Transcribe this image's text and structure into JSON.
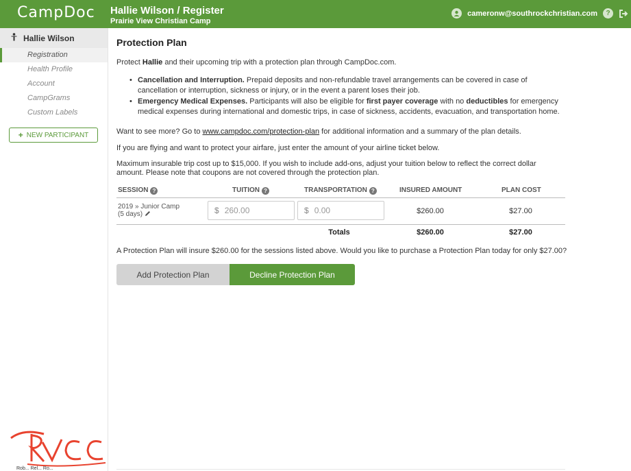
{
  "header": {
    "logo": "CampDoc",
    "title": "Hallie Wilson / Register",
    "subtitle": "Prairie View Christian Camp",
    "user_email": "cameronw@southrockchristian.com",
    "brand_color": "#5b9a3a"
  },
  "sidebar": {
    "participant_name": "Hallie Wilson",
    "items": [
      {
        "label": "Registration",
        "active": true
      },
      {
        "label": "Health Profile"
      },
      {
        "label": "Account"
      },
      {
        "label": "CampGrams"
      },
      {
        "label": "Custom Labels"
      }
    ],
    "new_participant_label": "NEW PARTICIPANT",
    "logo_text": "RVCC",
    "logo_tagline": "Rob... Rel... Ro..."
  },
  "main": {
    "title": "Protection Plan",
    "intro_pre": "Protect ",
    "intro_name": "Hallie",
    "intro_post": " and their upcoming trip with a protection plan through CampDoc.com.",
    "bullets": [
      {
        "heading": "Cancellation and Interruption.",
        "text": " Prepaid deposits and non-refundable travel arrangements can be covered in case of cancellation or interruption, sickness or injury, or in the event a parent loses their job."
      },
      {
        "heading": "Emergency Medical Expenses.",
        "text_a": " Participants will also be eligible for ",
        "bold_a": "first payer coverage",
        "text_b": " with no ",
        "bold_b": "deductibles",
        "text_c": " for emergency medical expenses during international and domestic trips, in case of sickness, accidents, evacuation, and transportation home."
      }
    ],
    "see_more_pre": "Want to see more? Go to ",
    "see_more_link": "www.campdoc.com/protection-plan",
    "see_more_post": " for additional information and a summary of the plan details.",
    "flying_text": "If you are flying and want to protect your airfare, just enter the amount of your airline ticket below.",
    "max_text": "Maximum insurable trip cost up to $15,000. If you wish to include add-ons, adjust your tuition below to reflect the correct dollar amount. Please note that coupons are not covered through the protection plan.",
    "table": {
      "headers": {
        "session": "SESSION",
        "tuition": "TUITION",
        "transportation": "TRANSPORTATION",
        "insured": "INSURED AMOUNT",
        "cost": "PLAN COST"
      },
      "row": {
        "session_name": "2019 » Junior Camp",
        "session_days": "(5 days)",
        "currency": "$",
        "tuition": "260.00",
        "transportation": "0.00",
        "insured": "$260.00",
        "cost": "$27.00"
      },
      "totals": {
        "label": "Totals",
        "insured": "$260.00",
        "cost": "$27.00"
      }
    },
    "summary": "A Protection Plan will insure $260.00 for the sessions listed above. Would you like to purchase a Protection Plan today for only $27.00?",
    "add_button": "Add Protection Plan",
    "decline_button": "Decline Protection Plan"
  }
}
